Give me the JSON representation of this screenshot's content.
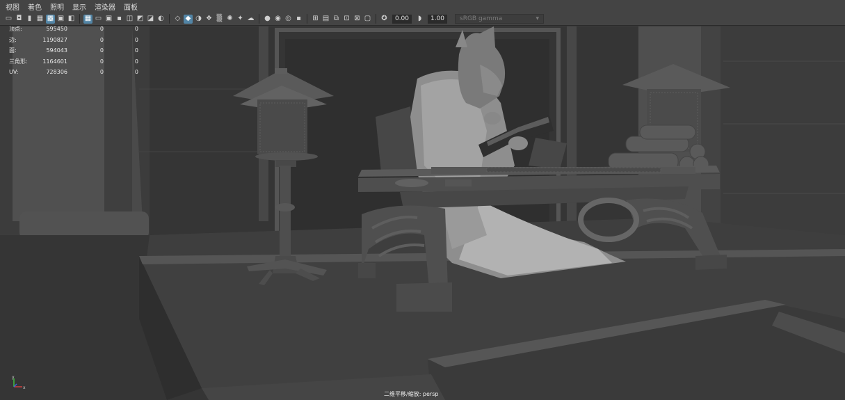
{
  "menu": [
    "视图",
    "着色",
    "照明",
    "显示",
    "渲染器",
    "面板"
  ],
  "toolbar": {
    "exposure_value": "0.00",
    "gamma_value": "1.00",
    "colorspace": "sRGB gamma"
  },
  "hud": {
    "rows": [
      {
        "label": "顶点:",
        "v1": "595450",
        "v2": "0",
        "v3": "0"
      },
      {
        "label": "边:",
        "v1": "1190827",
        "v2": "0",
        "v3": "0"
      },
      {
        "label": "面:",
        "v1": "594043",
        "v2": "0",
        "v3": "0"
      },
      {
        "label": "三角形:",
        "v1": "1164601",
        "v2": "0",
        "v3": "0"
      },
      {
        "label": "UV:",
        "v1": "728306",
        "v2": "0",
        "v3": "0"
      }
    ]
  },
  "camera_label": "二维平移/缩放: persp",
  "axis": {
    "y_label": "y",
    "x_label": "x",
    "x_color": "#d04040",
    "y_color": "#40c040",
    "z_color": "#4060e0"
  },
  "colors": {
    "menubar_bg": "#444444",
    "active_tool": "#5285a6",
    "viewport_bg": "#3a3a3a"
  }
}
